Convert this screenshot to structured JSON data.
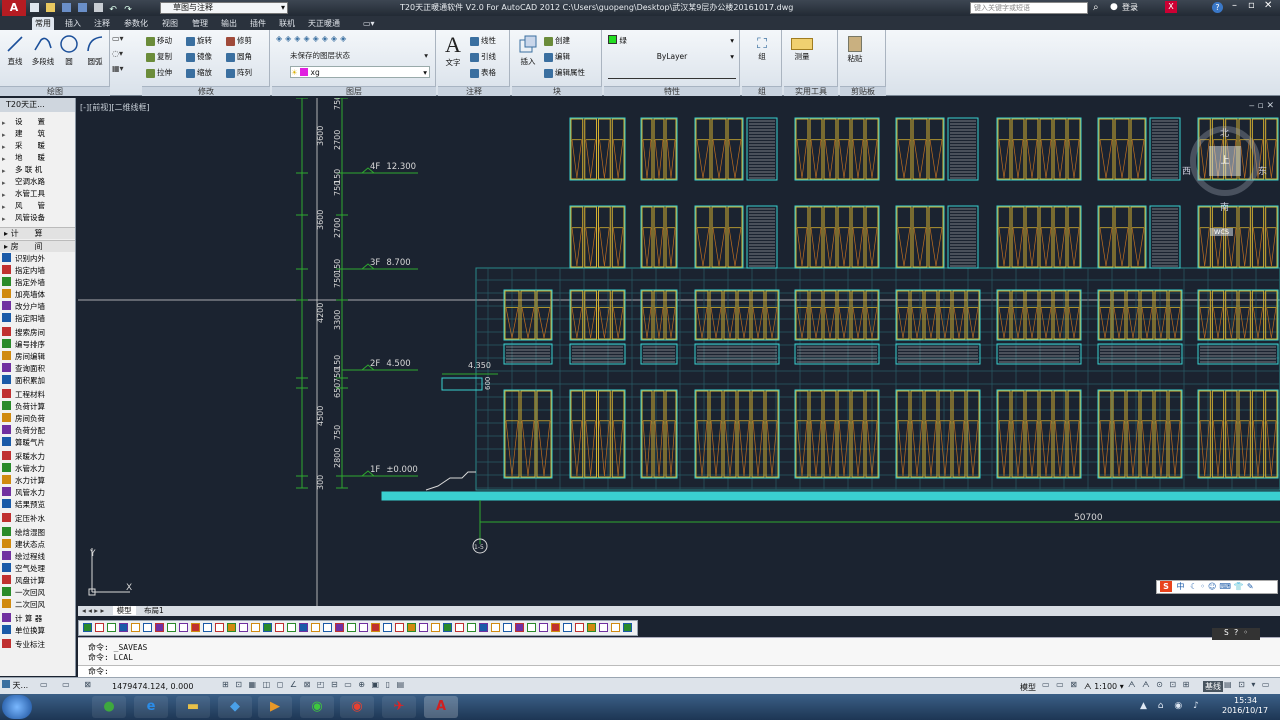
{
  "titlebar": {
    "workspace": "草图与注释",
    "title": "T20天正暖通软件 V2.0 For AutoCAD 2012    C:\\Users\\guopeng\\Desktop\\武汉某9层办公楼20161017.dwg",
    "search_placeholder": "键入关键字或短语",
    "login": "登录"
  },
  "ribbon_tabs": [
    "常用",
    "插入",
    "注释",
    "参数化",
    "视图",
    "管理",
    "输出",
    "插件",
    "联机",
    "天正暖通"
  ],
  "ribbon": {
    "draw": {
      "title": "绘图",
      "tools": [
        "直线",
        "多段线",
        "圆",
        "圆弧"
      ]
    },
    "modify": {
      "title": "修改",
      "tools": [
        "移动",
        "旋转",
        "修剪",
        "复制",
        "镜像",
        "圆角",
        "拉伸",
        "缩放",
        "阵列"
      ]
    },
    "layers": {
      "title": "图层",
      "state": "未保存的图层状态",
      "current": "xg"
    },
    "annotation": {
      "title": "注释",
      "text": "文字",
      "tools": [
        "线性",
        "引线",
        "表格"
      ]
    },
    "block": {
      "title": "块",
      "insert": "插入",
      "tools": [
        "创建",
        "编辑",
        "编辑属性"
      ]
    },
    "properties": {
      "title": "特性",
      "color": "绿",
      "linetype": "ByLayer"
    },
    "groups": {
      "title": "组",
      "label": "组"
    },
    "utilities": {
      "title": "实用工具",
      "measure": "测量"
    },
    "clipboard": {
      "title": "剪贴板",
      "paste": "粘贴"
    }
  },
  "palette": {
    "title": "T20天正...",
    "items": [
      "设　　置",
      "建　　筑",
      "采　　暖",
      "地　　暖",
      "多 联 机",
      "空调水路",
      "水管工具",
      "风　　管",
      "风管设备"
    ],
    "section_calc": "计　　算",
    "section_room": "房　　间",
    "room_items": [
      "识别内外",
      "指定内墙",
      "指定外墙",
      "加亮墙体",
      "改分户墙",
      "指定阳墙",
      "搜索房间",
      "编号排序",
      "房间编辑",
      "查询面积",
      "面积累加",
      "工程材料",
      "负荷计算",
      "房间负荷",
      "负荷分配",
      "算暖气片",
      "采暖水力",
      "水管水力",
      "水力计算",
      "风管水力",
      "结果预览",
      "定压补水",
      "绘焓湿图",
      "建状态点",
      "绘过程线",
      "空气处理",
      "风盘计算",
      "一次回风",
      "二次回风",
      "计 算 器",
      "单位换算",
      "专业标注"
    ]
  },
  "viewport": {
    "label": "[-][前视][二维线框]",
    "viewcube": {
      "north": "北",
      "south": "南",
      "east": "东",
      "west": "西",
      "top": "上",
      "wcs": "WCS"
    }
  },
  "drawing": {
    "levels": [
      {
        "name": "4F",
        "elev": "12.300"
      },
      {
        "name": "3F",
        "elev": "8.700"
      },
      {
        "name": "2F",
        "elev": "4.500"
      },
      {
        "name": "1F",
        "elev": "±0.000"
      }
    ],
    "outer_dims": [
      "3600",
      "3600",
      "4200",
      "4500",
      "300"
    ],
    "inner_dims": [
      "750",
      "2700",
      "150",
      "750",
      "2700",
      "150",
      "750",
      "3300",
      "150",
      "750",
      "650",
      "750",
      "2800",
      "150"
    ],
    "canopy_elev": "4.350",
    "canopy_dim": "600",
    "total_width": "50700",
    "grid_bubble": "1-5",
    "axis_x": "X",
    "axis_y": "Y"
  },
  "model_tabs": [
    "模型",
    "布局1"
  ],
  "command": {
    "lines": [
      "命令: _SAVEAS",
      "命令: LCAL"
    ],
    "prompt": "命令:"
  },
  "status": {
    "coords": "1479474.124, 0.000",
    "palette_short": "天...",
    "model": "模型",
    "scale": "1:100",
    "tianzheng": "基线"
  },
  "ime": {
    "label": "中"
  },
  "clock": {
    "time": "15:34",
    "date": "2016/10/17"
  }
}
